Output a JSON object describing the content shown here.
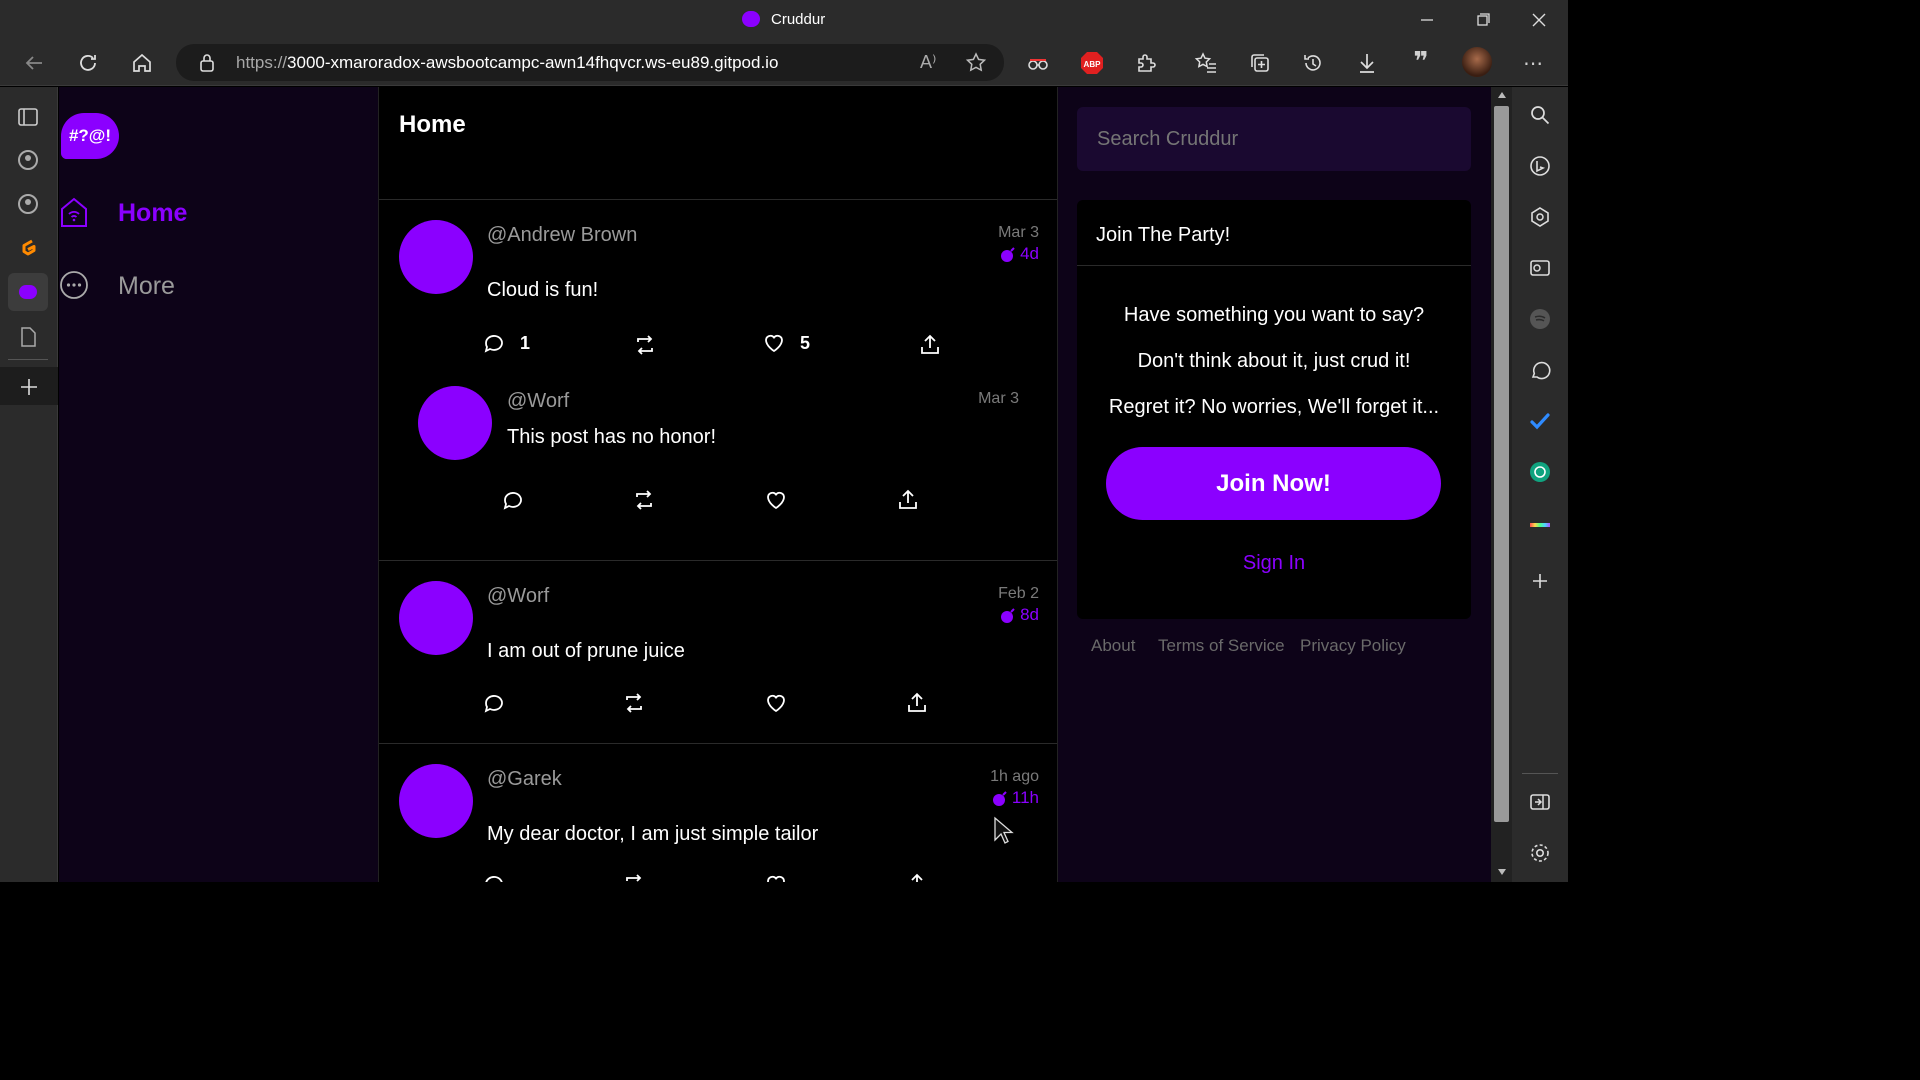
{
  "browser": {
    "tab_title": "Cruddur",
    "url_proto": "https://",
    "url_rest": "3000-xmaroradox-awsbootcampc-awn14fhqvcr.ws-eu89.gitpod.io",
    "window_controls": [
      "minimize",
      "restore",
      "close"
    ]
  },
  "app": {
    "logo_text": "#?@!",
    "nav": [
      {
        "label": "Home",
        "icon": "home-icon",
        "active": true
      },
      {
        "label": "More",
        "icon": "more-icon",
        "active": false
      }
    ],
    "feed_title": "Home"
  },
  "posts": [
    {
      "handle": "@Andrew Brown",
      "message": "Cloud is fun!",
      "date": "Mar 3",
      "expires": "4d",
      "replies_count": "1",
      "likes_count": "5",
      "reply": {
        "handle": "@Worf",
        "message": "This post has no honor!",
        "date": "Mar 3"
      }
    },
    {
      "handle": "@Worf",
      "message": "I am out of prune juice",
      "date": "Feb 2",
      "expires": "8d"
    },
    {
      "handle": "@Garek",
      "message": "My dear doctor, I am just simple tailor",
      "date": "1h ago",
      "expires": "11h"
    }
  ],
  "sidebar": {
    "search_placeholder": "Search Cruddur",
    "join": {
      "title": "Join The Party!",
      "lines": [
        "Have something you want to say?",
        "Don't think about it, just crud it!",
        "Regret it? No worries, We'll forget it..."
      ],
      "join_button": "Join Now!",
      "signin_link": "Sign In"
    },
    "footer_links": [
      "About",
      "Terms of Service",
      "Privacy Policy"
    ]
  },
  "colors": {
    "accent": "#8b00ff",
    "nav_bg": "#0d0318",
    "feed_bg": "#000000",
    "chrome_bg": "#2b2b2b"
  }
}
